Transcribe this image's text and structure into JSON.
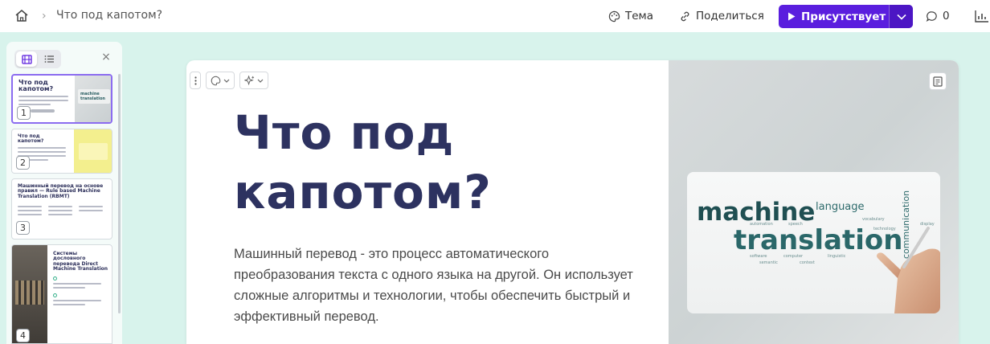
{
  "breadcrumb": {
    "title": "Что под капотом?"
  },
  "toolbar": {
    "theme_label": "Тема",
    "share_label": "Поделиться",
    "present_label": "Присутствует",
    "comments_count": "0"
  },
  "sidebar": {
    "thumbnails": [
      {
        "num": "1",
        "title": "Что под капотом?"
      },
      {
        "num": "2",
        "title": "Что под капотом?"
      },
      {
        "num": "3",
        "title": "Машинный перевод на основе правил — Rule based Machine Translation (RBMT)"
      },
      {
        "num": "4",
        "title": "Системы дословного перевода Direct Machine Translation"
      }
    ]
  },
  "slide": {
    "title": "Что под\nкапотом?",
    "body": "Машинный перевод - это процесс автоматического преобразования текста с одного языка на другой. Он использует сложные алгоритмы и технологии, чтобы обеспечить быстрый и эффективный перевод.",
    "image_words": {
      "big1": "machine",
      "big2": "translation",
      "w1": "language",
      "w2": "communication"
    }
  },
  "colors": {
    "accent": "#5a1ede",
    "bg": "#d8f3ec",
    "title": "#2d3260"
  }
}
